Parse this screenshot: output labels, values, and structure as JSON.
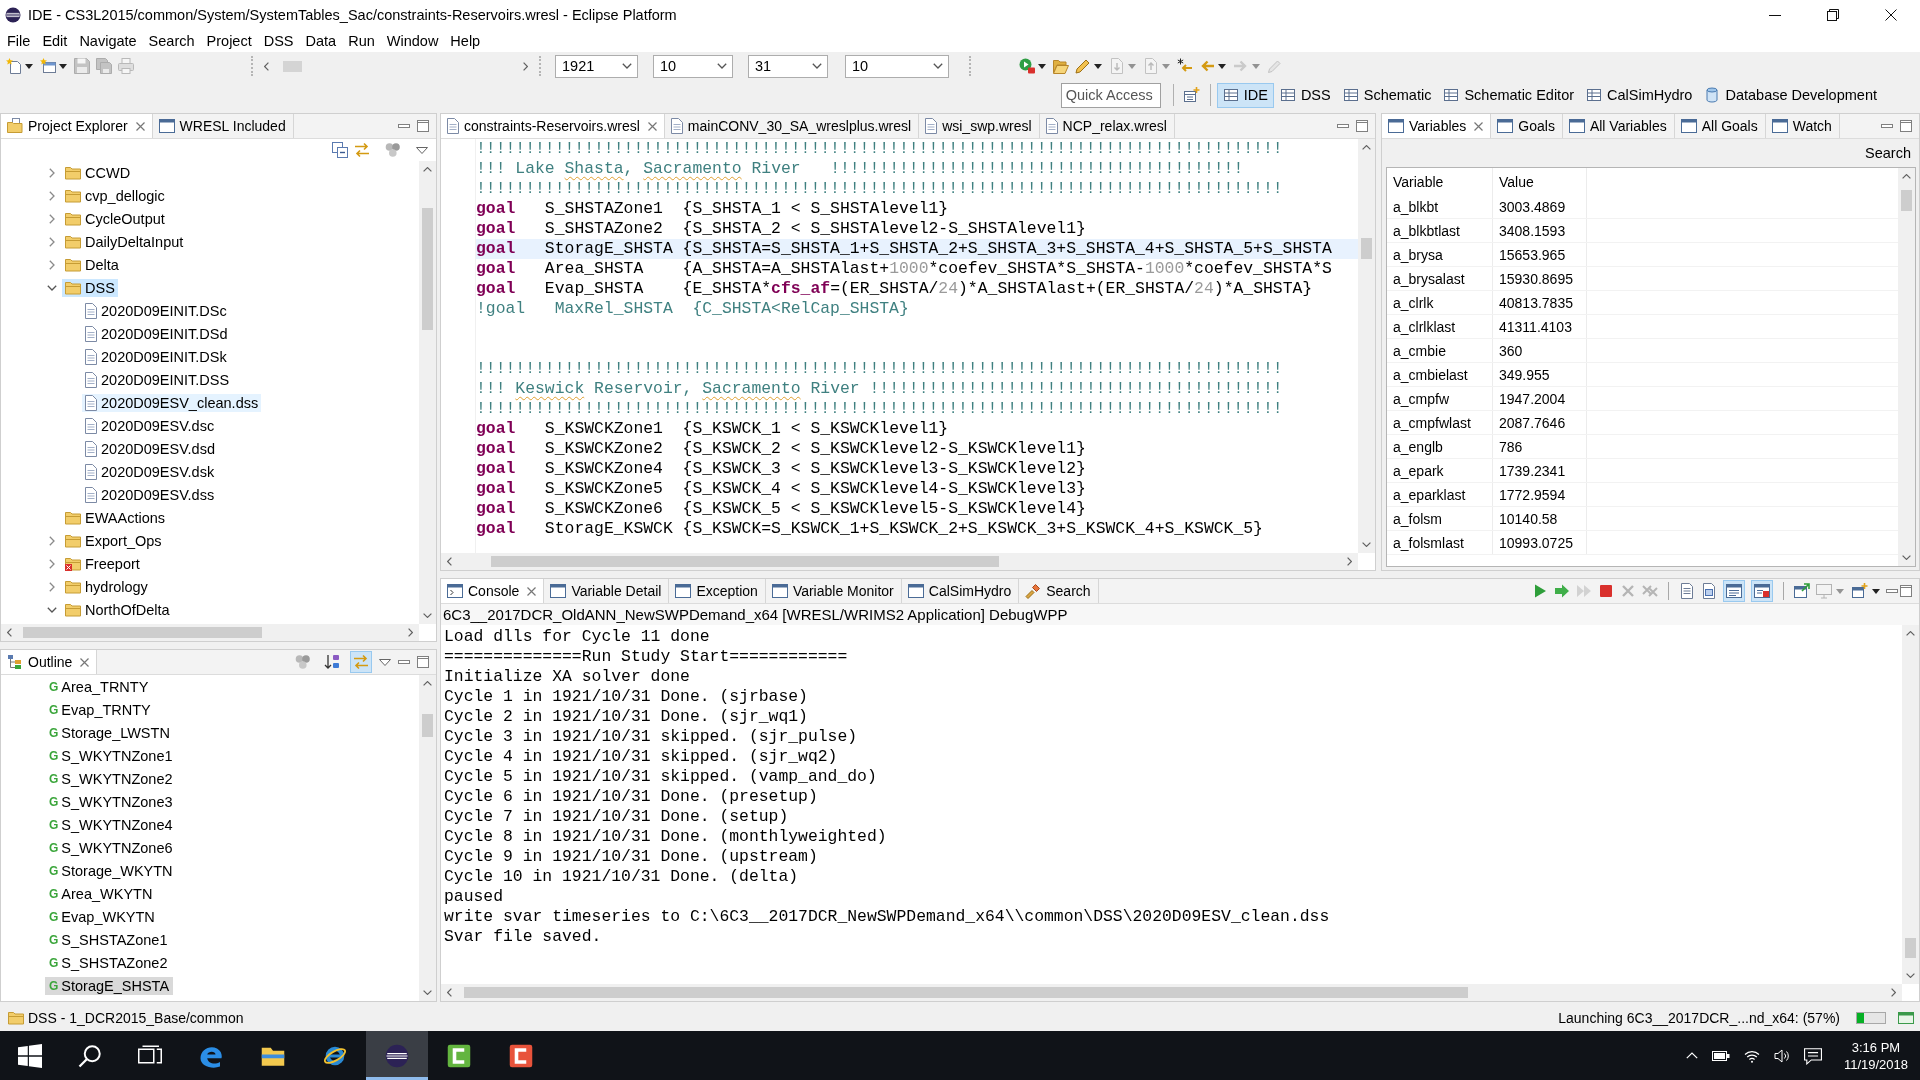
{
  "window": {
    "title": "IDE - CS3L2015/common/System/SystemTables_Sac/constraints-Reservoirs.wresl - Eclipse Platform"
  },
  "menu": [
    "File",
    "Edit",
    "Navigate",
    "Search",
    "Project",
    "DSS",
    "Data",
    "Run",
    "Window",
    "Help"
  ],
  "toolbar": {
    "left_buttons": [
      {
        "disabled": false
      },
      {
        "disabled": false
      },
      {
        "disabled": true
      },
      {
        "disabled": true
      },
      {
        "disabled": true
      }
    ],
    "combos": [
      {
        "value": "1921"
      },
      {
        "value": "10"
      },
      {
        "value": "31"
      },
      {
        "value": "10"
      }
    ],
    "right_buttons": [
      {
        "disabled": false
      },
      {
        "disabled": false
      },
      {
        "disabled": false
      },
      {
        "disabled": true
      },
      {
        "disabled": true
      },
      {
        "disabled": false
      },
      {
        "disabled": false
      },
      {
        "disabled": true
      },
      {
        "disabled": true
      }
    ]
  },
  "quick_access": {
    "placeholder": "Quick Access"
  },
  "perspectives": [
    {
      "label": "IDE",
      "selected": true
    },
    {
      "label": "DSS",
      "selected": false
    },
    {
      "label": "Schematic",
      "selected": false
    },
    {
      "label": "Schematic Editor",
      "selected": false
    },
    {
      "label": "CalSimHydro",
      "selected": false
    },
    {
      "label": "Database Development",
      "selected": false
    }
  ],
  "project_explorer": {
    "tabs": [
      {
        "label": "Project Explorer",
        "selected": true
      },
      {
        "label": "WRESL Included",
        "selected": false
      }
    ],
    "tree": [
      {
        "label": "CCWD",
        "kind": "folder",
        "expanded": false,
        "selected": false,
        "hovered": false,
        "error": false
      },
      {
        "label": "cvp_dellogic",
        "kind": "folder",
        "expanded": false,
        "selected": false,
        "hovered": false,
        "error": false
      },
      {
        "label": "CycleOutput",
        "kind": "folder",
        "expanded": false,
        "selected": false,
        "hovered": false,
        "error": false
      },
      {
        "label": "DailyDeltaInput",
        "kind": "folder",
        "expanded": false,
        "selected": false,
        "hovered": false,
        "error": false
      },
      {
        "label": "Delta",
        "kind": "folder",
        "expanded": false,
        "selected": false,
        "hovered": false,
        "error": false
      },
      {
        "label": "DSS",
        "kind": "folder",
        "expanded": true,
        "selected": true,
        "hovered": false,
        "error": false,
        "children": [
          {
            "label": "2020D09EINIT.DSc",
            "kind": "file",
            "selected": false,
            "hovered": false
          },
          {
            "label": "2020D09EINIT.DSd",
            "kind": "file",
            "selected": false,
            "hovered": false
          },
          {
            "label": "2020D09EINIT.DSk",
            "kind": "file",
            "selected": false,
            "hovered": false
          },
          {
            "label": "2020D09EINIT.DSS",
            "kind": "file",
            "selected": false,
            "hovered": false
          },
          {
            "label": "2020D09ESV_clean.dss",
            "kind": "file",
            "selected": false,
            "hovered": true
          },
          {
            "label": "2020D09ESV.dsc",
            "kind": "file",
            "selected": false,
            "hovered": false
          },
          {
            "label": "2020D09ESV.dsd",
            "kind": "file",
            "selected": false,
            "hovered": false
          },
          {
            "label": "2020D09ESV.dsk",
            "kind": "file",
            "selected": false,
            "hovered": false
          },
          {
            "label": "2020D09ESV.dss",
            "kind": "file",
            "selected": false,
            "hovered": false
          }
        ]
      },
      {
        "label": "EWAActions",
        "kind": "folder",
        "selected": false,
        "hovered": false,
        "error": false
      },
      {
        "label": "Export_Ops",
        "kind": "folder",
        "expanded": false,
        "selected": false,
        "hovered": false,
        "error": false
      },
      {
        "label": "Freeport",
        "kind": "folder",
        "expanded": false,
        "selected": false,
        "hovered": false,
        "error": true
      },
      {
        "label": "hydrology",
        "kind": "folder",
        "expanded": false,
        "selected": false,
        "hovered": false,
        "error": false
      },
      {
        "label": "NorthOfDelta",
        "kind": "folder",
        "expanded": true,
        "selected": false,
        "hovered": false,
        "error": false
      }
    ]
  },
  "outline": {
    "tabs": [
      {
        "label": "Outline",
        "selected": true
      }
    ],
    "toolbar": [
      {
        "on": false
      },
      {
        "on": false
      },
      {
        "on": true
      }
    ],
    "items": [
      {
        "marker": "G",
        "label": "Area_TRNTY",
        "selected": false
      },
      {
        "marker": "G",
        "label": "Evap_TRNTY",
        "selected": false
      },
      {
        "marker": "G",
        "label": "Storage_LWSTN",
        "selected": false
      },
      {
        "marker": "G",
        "label": "S_WKYTNZone1",
        "selected": false
      },
      {
        "marker": "G",
        "label": "S_WKYTNZone2",
        "selected": false
      },
      {
        "marker": "G",
        "label": "S_WKYTNZone3",
        "selected": false
      },
      {
        "marker": "G",
        "label": "S_WKYTNZone4",
        "selected": false
      },
      {
        "marker": "G",
        "label": "S_WKYTNZone6",
        "selected": false
      },
      {
        "marker": "G",
        "label": "Storage_WKYTN",
        "selected": false
      },
      {
        "marker": "G",
        "label": "Area_WKYTN",
        "selected": false
      },
      {
        "marker": "G",
        "label": "Evap_WKYTN",
        "selected": false
      },
      {
        "marker": "G",
        "label": "S_SHSTAZone1",
        "selected": false
      },
      {
        "marker": "G",
        "label": "S_SHSTAZone2",
        "selected": false
      },
      {
        "marker": "G",
        "label": "StoragE_SHSTA",
        "selected": true
      }
    ]
  },
  "editor": {
    "tabs": [
      {
        "label": "constraints-Reservoirs.wresl",
        "selected": true
      },
      {
        "label": "mainCONV_30_SA_wreslplus.wresl",
        "selected": false
      },
      {
        "label": "wsi_swp.wresl",
        "selected": false
      },
      {
        "label": "NCP_relax.wresl",
        "selected": false
      }
    ],
    "lines": [
      {
        "current": false,
        "tokens": [
          {
            "kind": "comment",
            "text": "!!!!!!!!!!!!!!!!!!!!!!!!!!!!!!!!!!!!!!!!!!!!!!!!!!!!!!!!!!!!!!!!!!!!!!!!!!!!!!!!!!"
          }
        ]
      },
      {
        "current": false,
        "tokens": [
          {
            "kind": "comment",
            "text": "!!! Lake "
          },
          {
            "kind": "misspelled",
            "text": "Shasta"
          },
          {
            "kind": "comment",
            "text": ", "
          },
          {
            "kind": "misspelled",
            "text": "Sacramento"
          },
          {
            "kind": "comment",
            "text": " River   !!!!!!!!!!!!!!!!!!!!!!!!!!!!!!!!!!!!!!!!!!"
          }
        ]
      },
      {
        "current": false,
        "tokens": [
          {
            "kind": "comment",
            "text": "!!!!!!!!!!!!!!!!!!!!!!!!!!!!!!!!!!!!!!!!!!!!!!!!!!!!!!!!!!!!!!!!!!!!!!!!!!!!!!!!!!"
          }
        ]
      },
      {
        "current": false,
        "tokens": [
          {
            "kind": "keyword",
            "text": "goal"
          },
          {
            "kind": "plain",
            "text": "   S_SHSTAZone1  {S_SHSTA_1 < S_SHSTAlevel1}"
          }
        ]
      },
      {
        "current": false,
        "tokens": [
          {
            "kind": "keyword",
            "text": "goal"
          },
          {
            "kind": "plain",
            "text": "   S_SHSTAZone2  {S_SHSTA_2 < S_SHSTAlevel2-S_SHSTAlevel1}"
          }
        ]
      },
      {
        "current": true,
        "tokens": [
          {
            "kind": "keyword",
            "text": "goal"
          },
          {
            "kind": "plain",
            "text": "   StoragE_SHSTA {S_SHSTA=S_SHSTA_1+S_SHSTA_2+S_SHSTA_3+S_SHSTA_4+S_SHSTA_5+S_SHSTA"
          }
        ]
      },
      {
        "current": false,
        "tokens": [
          {
            "kind": "keyword",
            "text": "goal"
          },
          {
            "kind": "plain",
            "text": "   Area_SHSTA    {A_SHSTA=A_SHSTAlast+"
          },
          {
            "kind": "number",
            "text": "1000"
          },
          {
            "kind": "plain",
            "text": "*coefev_SHSTA*S_SHSTA-"
          },
          {
            "kind": "number",
            "text": "1000"
          },
          {
            "kind": "plain",
            "text": "*coefev_SHSTA*S"
          }
        ]
      },
      {
        "current": false,
        "tokens": [
          {
            "kind": "keyword",
            "text": "goal"
          },
          {
            "kind": "plain",
            "text": "   Evap_SHSTA    {E_SHSTA*"
          },
          {
            "kind": "keyword",
            "text": "cfs_af"
          },
          {
            "kind": "plain",
            "text": "=(ER_SHSTA/"
          },
          {
            "kind": "number",
            "text": "24"
          },
          {
            "kind": "plain",
            "text": ")*A_SHSTAlast+(ER_SHSTA/"
          },
          {
            "kind": "number",
            "text": "24"
          },
          {
            "kind": "plain",
            "text": ")*A_SHSTA}"
          }
        ]
      },
      {
        "current": false,
        "tokens": [
          {
            "kind": "comment",
            "text": "!goal   MaxRel_SHSTA  {C_SHSTA<RelCap_SHSTA}"
          }
        ]
      },
      {
        "current": false
      },
      {
        "current": false
      },
      {
        "current": false,
        "tokens": [
          {
            "kind": "comment",
            "text": "!!!!!!!!!!!!!!!!!!!!!!!!!!!!!!!!!!!!!!!!!!!!!!!!!!!!!!!!!!!!!!!!!!!!!!!!!!!!!!!!!!"
          }
        ]
      },
      {
        "current": false,
        "tokens": [
          {
            "kind": "comment",
            "text": "!!! "
          },
          {
            "kind": "misspelled",
            "text": "Keswick"
          },
          {
            "kind": "comment",
            "text": " Reservoir, "
          },
          {
            "kind": "misspelled",
            "text": "Sacramento"
          },
          {
            "kind": "comment",
            "text": " River !!!!!!!!!!!!!!!!!!!!!!!!!!!!!!!!!!!!!!!!!!"
          }
        ]
      },
      {
        "current": false,
        "tokens": [
          {
            "kind": "comment",
            "text": "!!!!!!!!!!!!!!!!!!!!!!!!!!!!!!!!!!!!!!!!!!!!!!!!!!!!!!!!!!!!!!!!!!!!!!!!!!!!!!!!!!"
          }
        ]
      },
      {
        "current": false,
        "tokens": [
          {
            "kind": "keyword",
            "text": "goal"
          },
          {
            "kind": "plain",
            "text": "   S_KSWCKZone1  {S_KSWCK_1 < S_KSWCKlevel1}"
          }
        ]
      },
      {
        "current": false,
        "tokens": [
          {
            "kind": "keyword",
            "text": "goal"
          },
          {
            "kind": "plain",
            "text": "   S_KSWCKZone2  {S_KSWCK_2 < S_KSWCKlevel2-S_KSWCKlevel1}"
          }
        ]
      },
      {
        "current": false,
        "tokens": [
          {
            "kind": "keyword",
            "text": "goal"
          },
          {
            "kind": "plain",
            "text": "   S_KSWCKZone4  {S_KSWCK_3 < S_KSWCKlevel3-S_KSWCKlevel2}"
          }
        ]
      },
      {
        "current": false,
        "tokens": [
          {
            "kind": "keyword",
            "text": "goal"
          },
          {
            "kind": "plain",
            "text": "   S_KSWCKZone5  {S_KSWCK_4 < S_KSWCKlevel4-S_KSWCKlevel3}"
          }
        ]
      },
      {
        "current": false,
        "tokens": [
          {
            "kind": "keyword",
            "text": "goal"
          },
          {
            "kind": "plain",
            "text": "   S_KSWCKZone6  {S_KSWCK_5 < S_KSWCKlevel5-S_KSWCKlevel4}"
          }
        ]
      },
      {
        "current": false,
        "tokens": [
          {
            "kind": "keyword",
            "text": "goal"
          },
          {
            "kind": "plain",
            "text": "   StoragE_KSWCK {S_KSWCK=S_KSWCK_1+S_KSWCK_2+S_KSWCK_3+S_KSWCK_4+S_KSWCK_5}"
          }
        ]
      }
    ]
  },
  "variables": {
    "tabs": [
      {
        "label": "Variables",
        "selected": true
      },
      {
        "label": "Goals",
        "selected": false
      },
      {
        "label": "All Variables",
        "selected": false
      },
      {
        "label": "All Goals",
        "selected": false
      },
      {
        "label": "Watch",
        "selected": false
      }
    ],
    "search_label": "Search",
    "columns": [
      "Variable",
      "Value"
    ],
    "rows": [
      [
        "a_blkbt",
        "3003.4869"
      ],
      [
        "a_blkbtlast",
        "3408.1593"
      ],
      [
        "a_brysa",
        "15653.965"
      ],
      [
        "a_brysalast",
        "15930.8695"
      ],
      [
        "a_clrlk",
        "40813.7835"
      ],
      [
        "a_clrlklast",
        "41311.4103"
      ],
      [
        "a_cmbie",
        "360"
      ],
      [
        "a_cmbielast",
        "349.955"
      ],
      [
        "a_cmpfw",
        "1947.2004"
      ],
      [
        "a_cmpfwlast",
        "2087.7646"
      ],
      [
        "a_englb",
        "786"
      ],
      [
        "a_epark",
        "1739.2341"
      ],
      [
        "a_eparklast",
        "1772.9594"
      ],
      [
        "a_folsm",
        "10140.58"
      ],
      [
        "a_folsmlast",
        "10993.0725"
      ]
    ]
  },
  "console": {
    "tabs": [
      {
        "label": "Console",
        "selected": true
      },
      {
        "label": "Variable Detail",
        "selected": false
      },
      {
        "label": "Exception",
        "selected": false
      },
      {
        "label": "Variable Monitor",
        "selected": false
      },
      {
        "label": "CalSimHydro",
        "selected": false
      },
      {
        "label": "Search",
        "selected": false
      }
    ],
    "toolbar": [
      {
        "on": false,
        "disabled": false
      },
      {
        "on": false,
        "disabled": false
      },
      {
        "on": false,
        "disabled": true
      },
      {
        "on": false,
        "disabled": false
      },
      {
        "on": false,
        "disabled": true
      },
      {
        "on": false,
        "disabled": true
      },
      {
        "on": false,
        "disabled": false
      },
      {
        "on": false,
        "disabled": false
      },
      {
        "on": true,
        "disabled": false
      },
      {
        "on": true,
        "disabled": false
      },
      {
        "on": false,
        "disabled": false
      },
      {
        "on": false,
        "disabled": true
      },
      {
        "on": false,
        "disabled": false
      }
    ],
    "process": "6C3__2017DCR_OldANN_NewSWPDemand_x64 [WRESL/WRIMS2 Application] DebugWPP",
    "lines": [
      "Load dlls for Cycle 11 done",
      "==============Run Study Start============",
      "Initialize XA solver done",
      "Cycle 1 in 1921/10/31 Done. (sjrbase)",
      "Cycle 2 in 1921/10/31 Done. (sjr_wq1)",
      "Cycle 3 in 1921/10/31 skipped. (sjr_pulse)",
      "Cycle 4 in 1921/10/31 skipped. (sjr_wq2)",
      "Cycle 5 in 1921/10/31 skipped. (vamp_and_do)",
      "Cycle 6 in 1921/10/31 Done. (presetup)",
      "Cycle 7 in 1921/10/31 Done. (setup)",
      "Cycle 8 in 1921/10/31 Done. (monthlyweighted)",
      "Cycle 9 in 1921/10/31 Done. (upstream)",
      "Cycle 10 in 1921/10/31 Done. (delta)",
      "paused",
      "write svar timeseries to C:\\6C3__2017DCR_NewSWPDemand_x64\\\\common\\DSS\\2020D09ESV_clean.dss",
      "Svar file saved."
    ]
  },
  "status_bar": {
    "text": "DSS - 1_DCR2015_Base/common",
    "progress_text": "Launching 6C3__2017DCR_...nd_x64: (57%)",
    "level": 0.25
  },
  "taskbar": {
    "apps": [
      {
        "selected": false
      },
      {
        "selected": false
      },
      {
        "selected": false
      },
      {
        "selected": true
      },
      {
        "selected": false
      },
      {
        "selected": false
      }
    ],
    "time": "3:16 PM",
    "date": "11/19/2018"
  }
}
